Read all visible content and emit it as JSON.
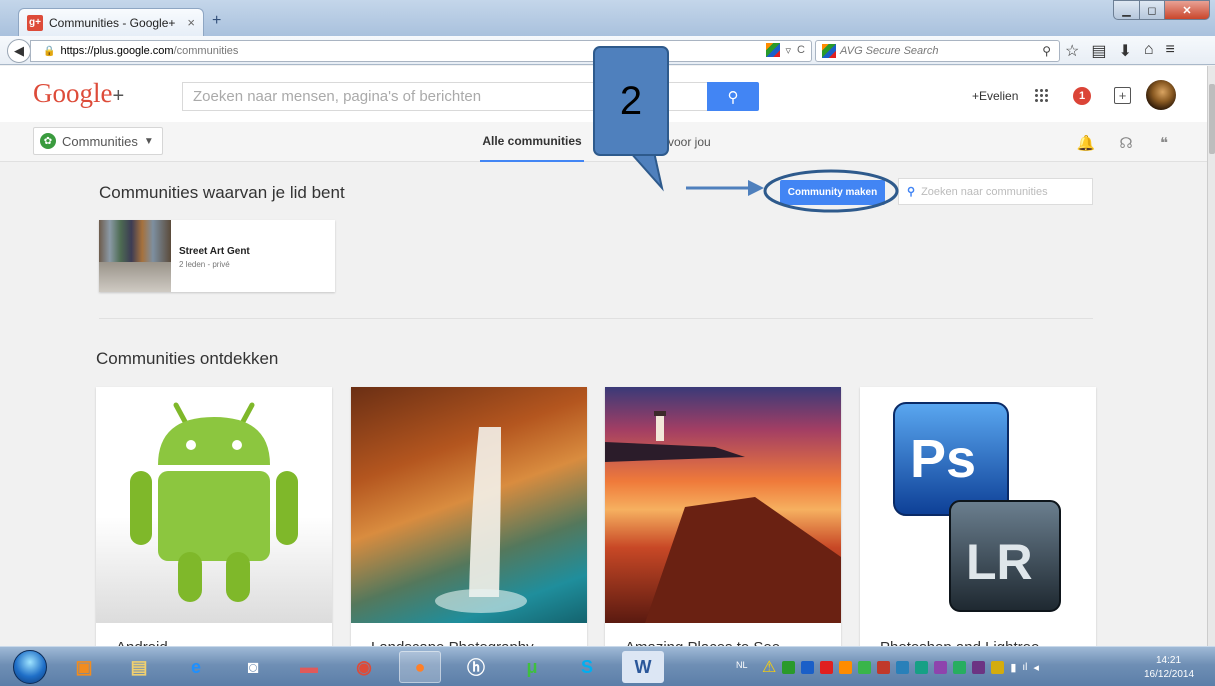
{
  "browser": {
    "tab_title": "Communities - Google+",
    "tab_close": "×",
    "new_tab": "+",
    "url_host": "https://plus.google.com",
    "url_path": "/communities",
    "search_placeholder": "AVG Secure Search"
  },
  "header": {
    "logo": "Google",
    "logo_plus": "+",
    "search_placeholder": "Zoeken naar mensen, pagina's of berichten",
    "user": "+Evelien",
    "notification_count": "1"
  },
  "subnav": {
    "dropdown_label": "Communities",
    "tab_all": "Alle communities",
    "tab_for_you": "n voor jou"
  },
  "member_section": {
    "title": "Communities waarvan je lid bent",
    "create_button": "Community maken",
    "search_placeholder": "Zoeken naar communities",
    "communities": [
      {
        "name": "Street Art Gent",
        "meta": "2 leden - privé"
      }
    ]
  },
  "discover": {
    "title": "Communities ontdekken",
    "cards": [
      {
        "name": "Android"
      },
      {
        "name": "Landscape Photography"
      },
      {
        "name": "Amazing Places to See"
      },
      {
        "name": "Photoshop and Lightroo"
      }
    ],
    "photoshop_logo": "Ps",
    "lightroom_logo": "LR"
  },
  "annotation": {
    "callout_number": "2"
  },
  "taskbar": {
    "language": "NL",
    "time": "14:21",
    "date": "16/12/2014"
  },
  "colors": {
    "accent": "#4285f4",
    "brand_red": "#dd4b39",
    "callout": "#4f80bd"
  }
}
